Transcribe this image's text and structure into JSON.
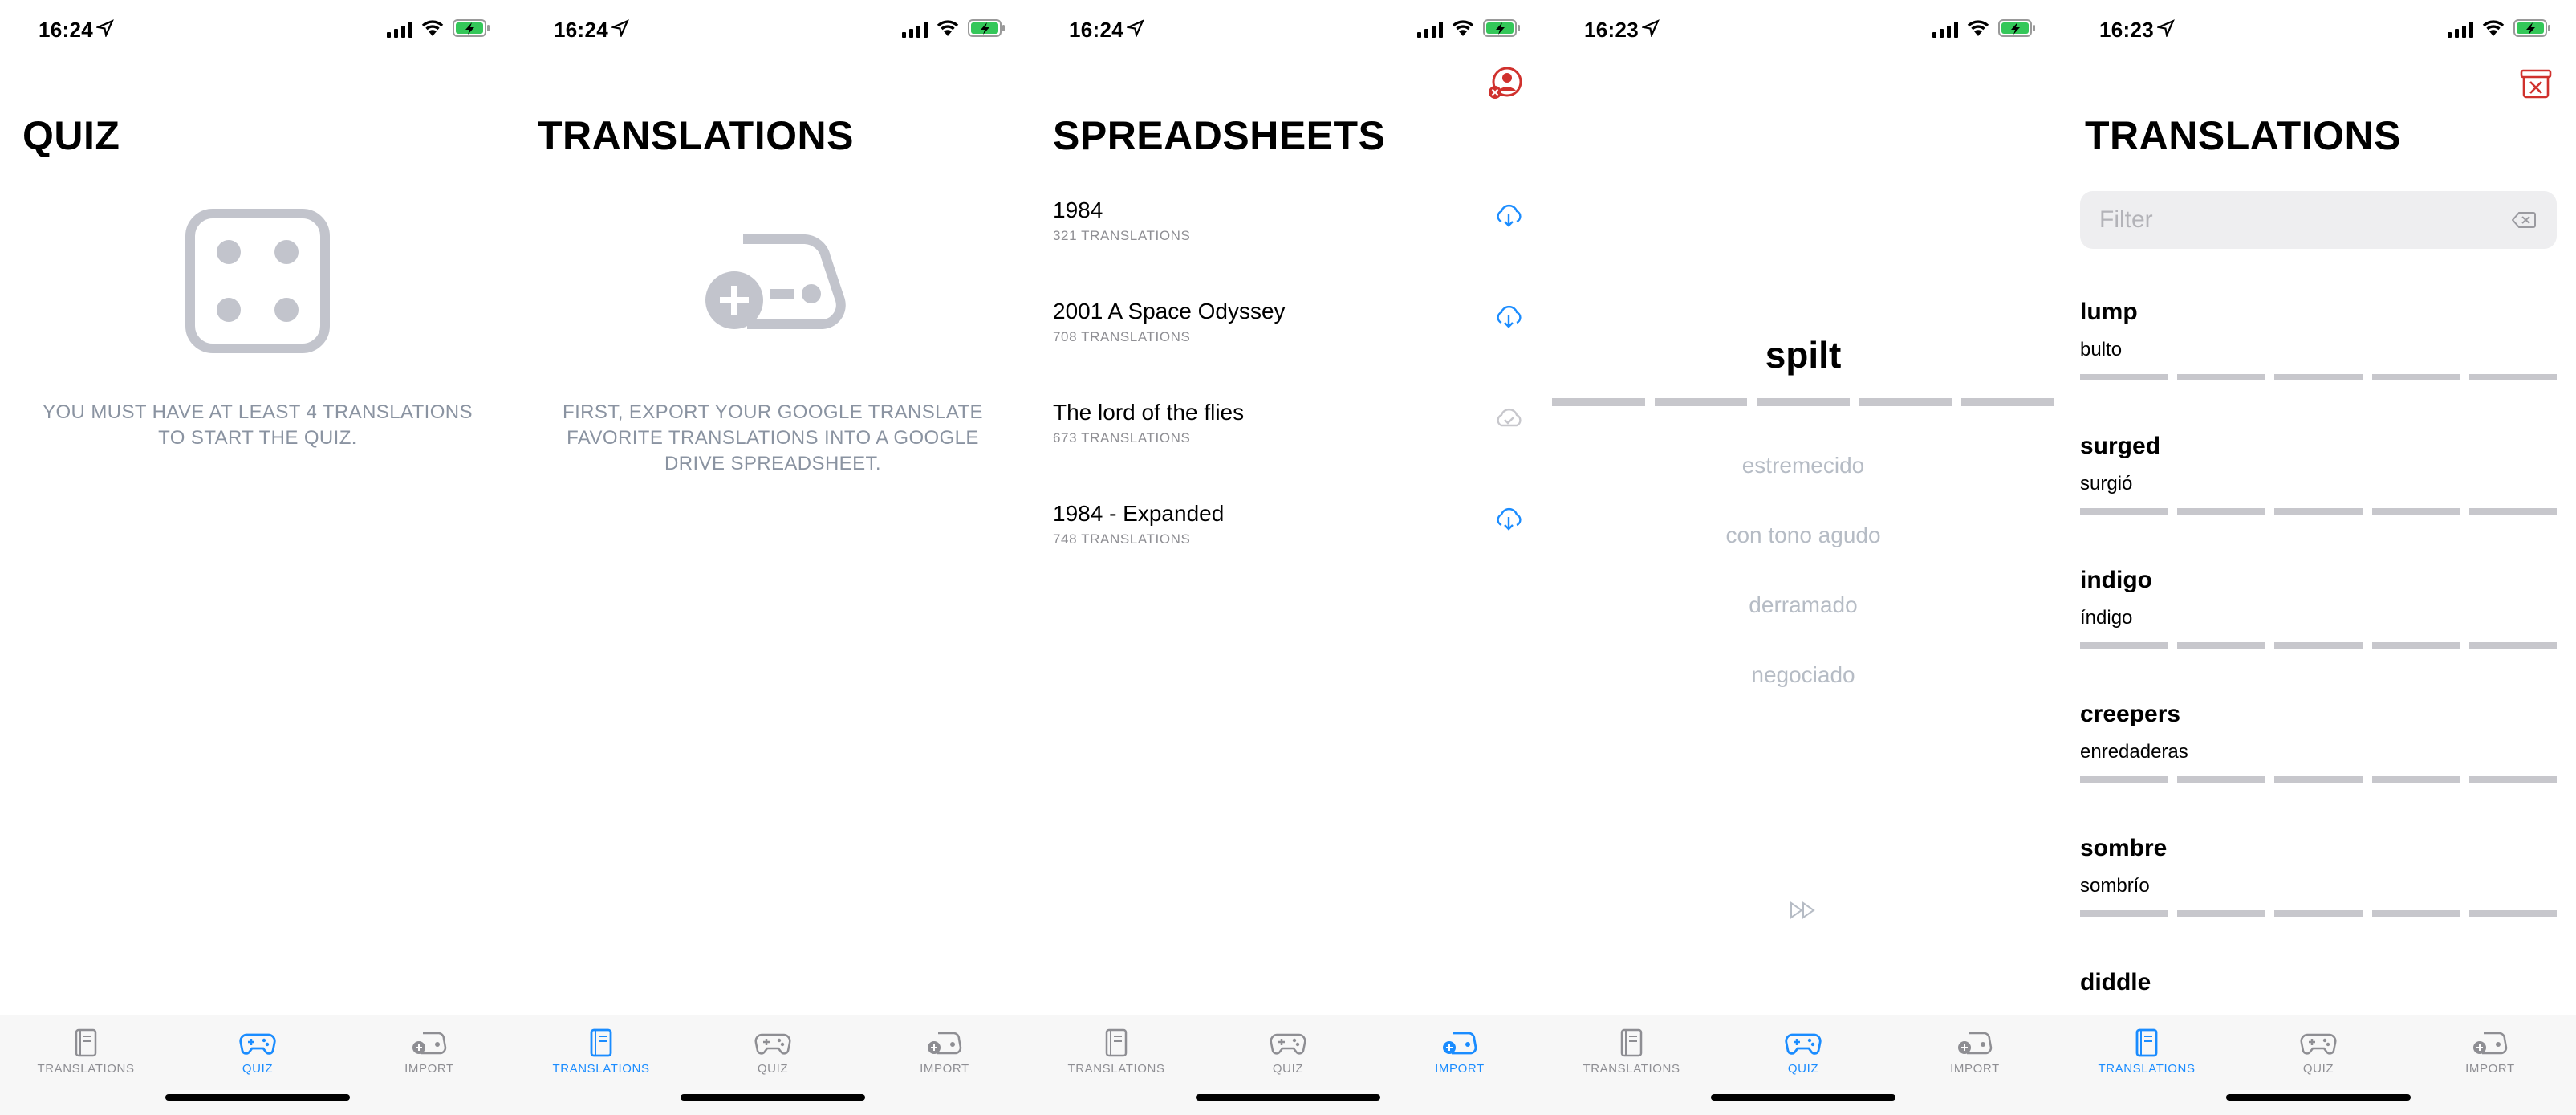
{
  "status": {
    "screens": [
      {
        "time": "16:24"
      },
      {
        "time": "16:24"
      },
      {
        "time": "16:24"
      },
      {
        "time": "16:23"
      },
      {
        "time": "16:23"
      }
    ]
  },
  "tabs": {
    "translations": "TRANSLATIONS",
    "quiz": "QUIZ",
    "import": "IMPORT"
  },
  "quiz_empty": {
    "title": "QUIZ",
    "message": "YOU MUST HAVE AT LEAST 4 TRANSLATIONS TO START THE QUIZ.",
    "icon": "dice-icon"
  },
  "translations_empty": {
    "title": "TRANSLATIONS",
    "message": "FIRST, EXPORT YOUR GOOGLE TRANSLATE FAVORITE TRANSLATIONS INTO A GOOGLE DRIVE SPREADSHEET.",
    "icon": "gamepad-add-icon"
  },
  "spreadsheets": {
    "title": "SPREADSHEETS",
    "action_icon": "sign-out-icon",
    "items": [
      {
        "name": "1984",
        "count": "321 TRANSLATIONS",
        "icon": "cloud-download-icon",
        "enabled": true
      },
      {
        "name": "2001 A Space Odyssey",
        "count": "708 TRANSLATIONS",
        "icon": "cloud-download-icon",
        "enabled": true
      },
      {
        "name": "The lord of the flies",
        "count": "673 TRANSLATIONS",
        "icon": "cloud-done-icon",
        "enabled": false
      },
      {
        "name": "1984 - Expanded",
        "count": "748 TRANSLATIONS",
        "icon": "cloud-download-icon",
        "enabled": true
      }
    ]
  },
  "quiz": {
    "word": "spilt",
    "progress_steps": 5,
    "options": [
      "estremecido",
      "con tono agudo",
      "derramado",
      "negociado"
    ],
    "skip_icon": "fast-forward-icon"
  },
  "translations": {
    "title": "TRANSLATIONS",
    "action_icon": "delete-all-icon",
    "filter_placeholder": "Filter",
    "items": [
      {
        "word": "lump",
        "translation": "bulto"
      },
      {
        "word": "surged",
        "translation": "surgió"
      },
      {
        "word": "indigo",
        "translation": "índigo"
      },
      {
        "word": "creepers",
        "translation": "enredaderas"
      },
      {
        "word": "sombre",
        "translation": "sombrío"
      },
      {
        "word": "diddle",
        "translation": ""
      }
    ]
  },
  "colors": {
    "accent": "#1a8cff",
    "muted_text": "#8a93a1",
    "icon_gray": "#c2c4cc",
    "danger": "#d0312d",
    "progress_bar": "#c7c7cc"
  }
}
